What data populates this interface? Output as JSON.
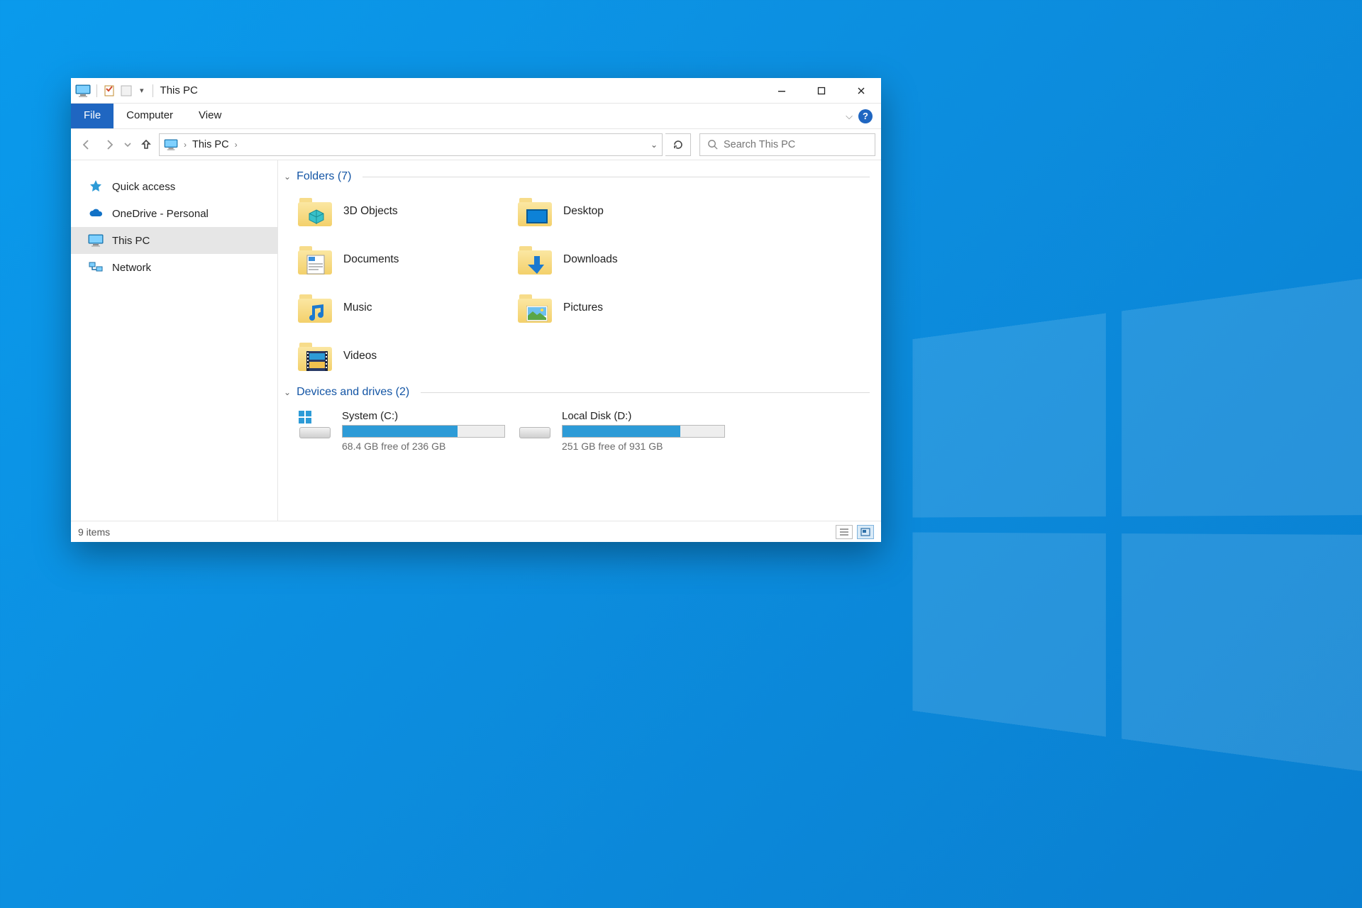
{
  "title": "This PC",
  "tabs": {
    "file": "File",
    "computer": "Computer",
    "view": "View"
  },
  "breadcrumb": {
    "root": "This PC"
  },
  "search": {
    "placeholder": "Search This PC"
  },
  "sidebar": {
    "items": [
      {
        "label": "Quick access"
      },
      {
        "label": "OneDrive - Personal"
      },
      {
        "label": "This PC"
      },
      {
        "label": "Network"
      }
    ]
  },
  "groups": {
    "folders": {
      "header": "Folders (7)"
    },
    "drives": {
      "header": "Devices and drives (2)"
    }
  },
  "folders": [
    {
      "label": "3D Objects"
    },
    {
      "label": "Desktop"
    },
    {
      "label": "Documents"
    },
    {
      "label": "Downloads"
    },
    {
      "label": "Music"
    },
    {
      "label": "Pictures"
    },
    {
      "label": "Videos"
    }
  ],
  "drives": [
    {
      "name": "System (C:)",
      "free": "68.4 GB free of 236 GB",
      "used_pct": 71
    },
    {
      "name": "Local Disk (D:)",
      "free": "251 GB free of 931 GB",
      "used_pct": 73
    }
  ],
  "status": {
    "count": "9 items"
  }
}
